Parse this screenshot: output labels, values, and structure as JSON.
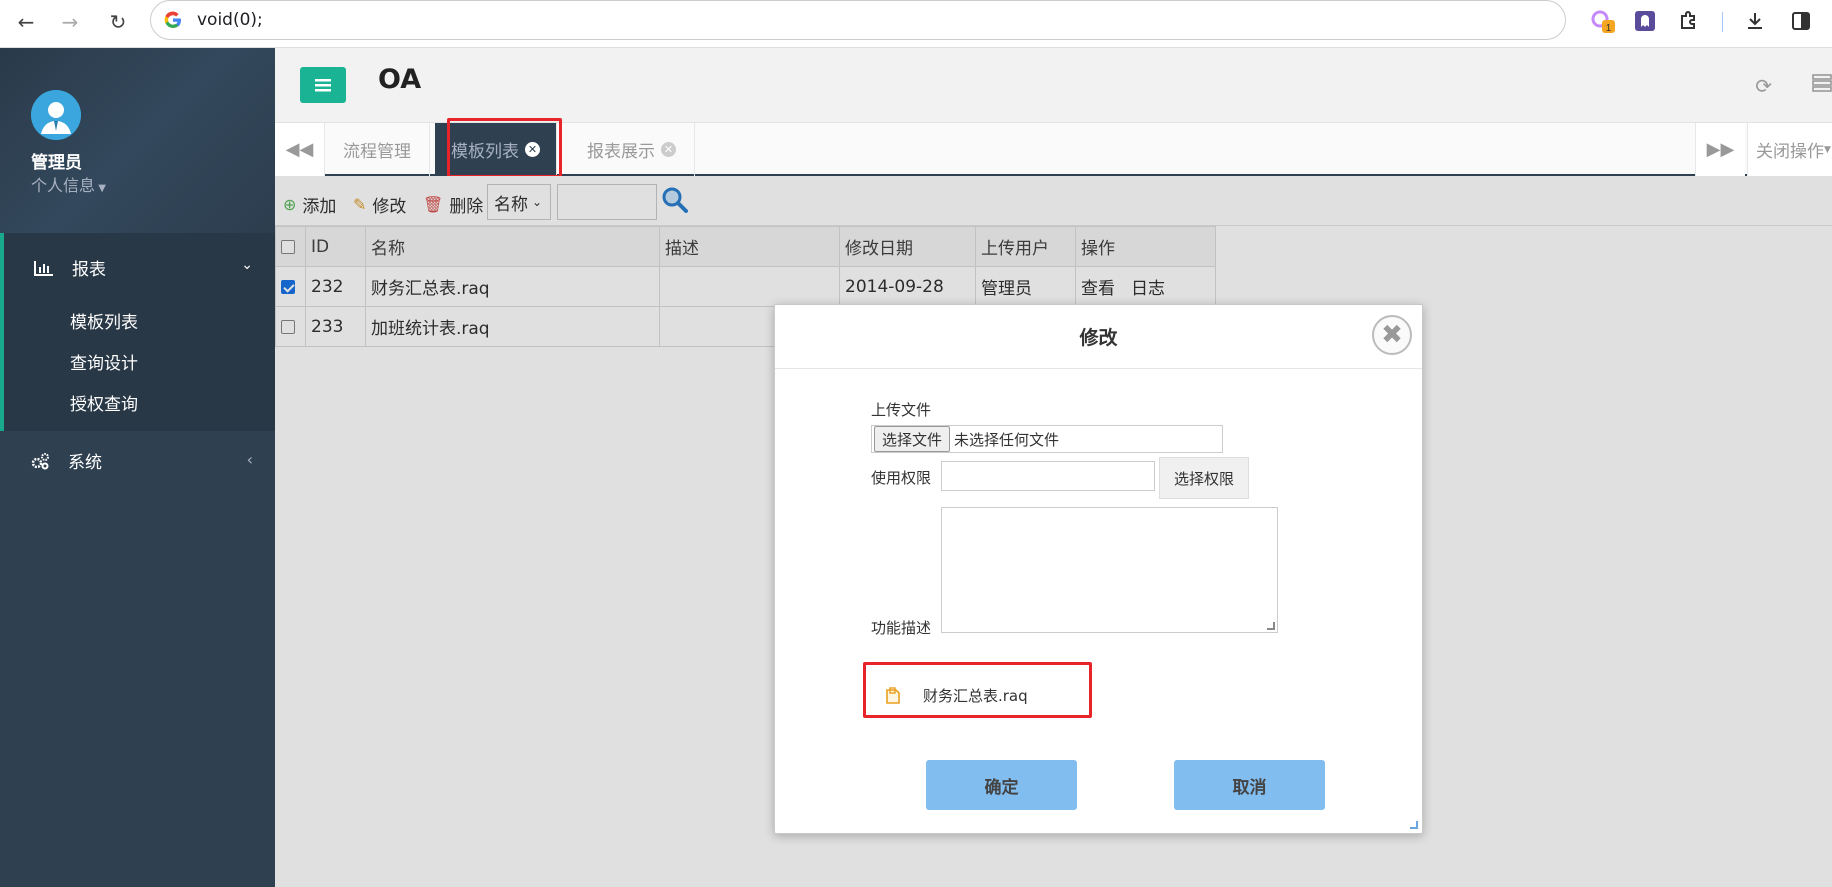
{
  "browser": {
    "url": "void(0);",
    "badge_count": "1"
  },
  "sidebar": {
    "user_name": "管理员",
    "user_info": "个人信息",
    "menu_report": "报表",
    "submenu": [
      "模板列表",
      "查询设计",
      "授权查询"
    ],
    "menu_system": "系统"
  },
  "header": {
    "title": "OA"
  },
  "tabs": {
    "items": [
      "流程管理",
      "模板列表",
      "报表展示"
    ],
    "close_ops": "关闭操作"
  },
  "toolbar": {
    "add": "添加",
    "edit": "修改",
    "delete": "删除",
    "field_select": "名称"
  },
  "table": {
    "columns": [
      "ID",
      "名称",
      "描述",
      "修改日期",
      "上传用户",
      "操作"
    ],
    "rows": [
      {
        "id": "232",
        "name": "财务汇总表.raq",
        "desc": "",
        "date": "2014-09-28",
        "user": "管理员",
        "op_view": "查看",
        "op_log": "日志",
        "checked": true
      },
      {
        "id": "233",
        "name": "加班统计表.raq",
        "desc": "",
        "date": "",
        "user": "",
        "op_view": "",
        "op_log": "",
        "checked": false
      }
    ]
  },
  "modal": {
    "title": "修改",
    "upload_label": "上传文件",
    "choose_file": "选择文件",
    "no_file": "未选择任何文件",
    "perm_label": "使用权限",
    "perm_button": "选择权限",
    "desc_label": "功能描述",
    "attachment": "财务汇总表.raq",
    "ok": "确定",
    "cancel": "取消"
  },
  "colors": {
    "sidebar_bg": "#2f4050",
    "accent_green": "#1ab394",
    "modal_button": "#82bdf0",
    "highlight_red": "#e8232a"
  }
}
